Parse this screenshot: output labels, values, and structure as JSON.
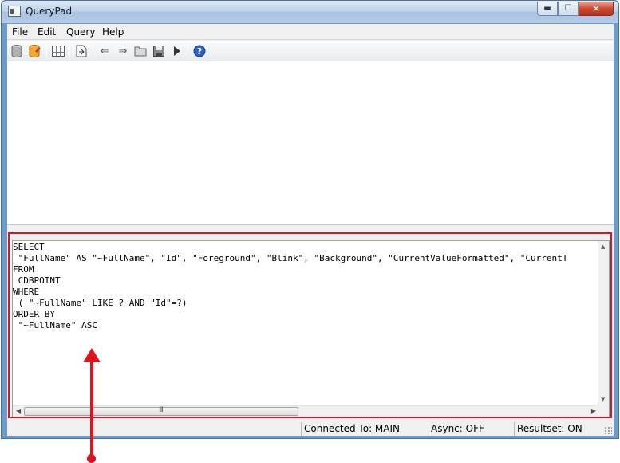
{
  "window": {
    "title": "QueryPad"
  },
  "window_controls": {
    "minimize": "▬",
    "maximize": "☐",
    "close": "✕"
  },
  "menu": {
    "items": [
      "File",
      "Edit",
      "Query",
      "Help"
    ]
  },
  "toolbar": {
    "icons": [
      "database-icon",
      "database-edit-icon",
      "grid-icon",
      "export-icon",
      "back-arrow-icon",
      "forward-arrow-icon",
      "open-folder-icon",
      "save-icon",
      "run-icon",
      "help-icon"
    ]
  },
  "editor": {
    "lines": [
      "SELECT",
      " \"FullName\" AS \"~FullName\", \"Id\", \"Foreground\", \"Blink\", \"Background\", \"CurrentValueFormatted\", \"CurrentT",
      "FROM",
      " CDBPOINT",
      "WHERE",
      " ( \"~FullName\" LIKE ? AND \"Id\"=?)",
      "ORDER BY",
      " \"~FullName\" ASC"
    ],
    "hscroll_grip": "III"
  },
  "status": {
    "connected": "Connected To: MAIN",
    "async": "Async: OFF",
    "resultset": "Resultset: ON"
  },
  "colors": {
    "highlight": "#e0121c",
    "title_bar": "#b9cfe8"
  }
}
